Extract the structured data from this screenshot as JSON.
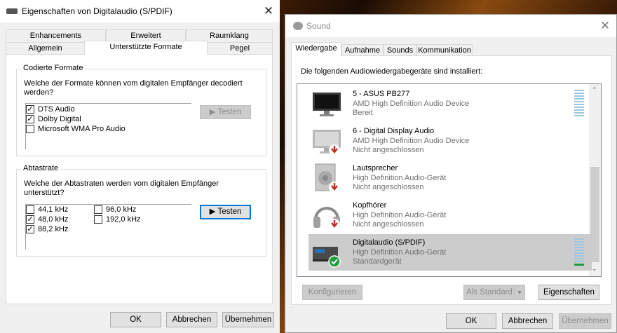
{
  "left_dialog": {
    "title": "Eigenschaften von Digitalaudio (S/PDIF)",
    "tabs_back": [
      "Enhancements",
      "Erweitert",
      "Raumklang"
    ],
    "tabs_front": [
      "Allgemein",
      "Unterstützte Formate",
      "Pegel"
    ],
    "coded_formats": {
      "label": "Codierte Formate",
      "question": "Welche der Formate können vom digitalen Empfänger decodiert werden?",
      "items": [
        {
          "label": "DTS Audio",
          "checked": "✓"
        },
        {
          "label": "Dolby Digital",
          "checked": "✓"
        },
        {
          "label": "Microsoft WMA Pro Audio",
          "checked": ""
        }
      ],
      "test_button": "▶ Testen"
    },
    "sample_rate": {
      "label": "Abtastrate",
      "question": "Welche der Abtastraten werden vom digitalen Empfänger unterstützt?",
      "col1": [
        {
          "label": "44,1 kHz",
          "checked": ""
        },
        {
          "label": "48,0 kHz",
          "checked": "✓"
        },
        {
          "label": "88,2 kHz",
          "checked": "✓"
        }
      ],
      "col2": [
        {
          "label": "96,0 kHz",
          "checked": ""
        },
        {
          "label": "192,0 kHz",
          "checked": ""
        }
      ],
      "test_button": "▶ Testen"
    },
    "buttons": {
      "ok": "OK",
      "cancel": "Abbrechen",
      "apply": "Übernehmen"
    }
  },
  "right_dialog": {
    "title": "Sound",
    "tabs": [
      "Wiedergabe",
      "Aufnahme",
      "Sounds",
      "Kommunikation"
    ],
    "intro": "Die folgenden Audiowiedergabegeräte sind installiert:",
    "devices": [
      {
        "name": "5 - ASUS PB277",
        "desc": "AMD High Definition Audio Device",
        "status": "Bereit",
        "icon": "monitor-icon",
        "badge": ""
      },
      {
        "name": "6 - Digital Display Audio",
        "desc": "AMD High Definition Audio Device",
        "status": "Nicht angeschlossen",
        "icon": "monitor-icon",
        "badge": "down-arrow"
      },
      {
        "name": "Lautsprecher",
        "desc": "High Definition Audio-Gerät",
        "status": "Nicht angeschlossen",
        "icon": "speaker-icon",
        "badge": "down-arrow"
      },
      {
        "name": "Kopfhörer",
        "desc": "High Definition Audio-Gerät",
        "status": "Nicht angeschlossen",
        "icon": "headphones-icon",
        "badge": "down-arrow"
      },
      {
        "name": "Digitalaudio (S/PDIF)",
        "desc": "High Definition Audio-Gerät",
        "status": "Standardgerät",
        "icon": "digital-receiver-icon",
        "badge": "check"
      }
    ],
    "buttons": {
      "configure": "Konfigurieren",
      "set_default": "Als Standard",
      "properties": "Eigenschaften",
      "ok": "OK",
      "cancel": "Abbrechen",
      "apply": "Übernehmen"
    }
  },
  "colors": {
    "accent": "#0078d7",
    "selection": "#cccccc",
    "status_green": "#1e9e3a",
    "status_red": "#c42b1c"
  }
}
